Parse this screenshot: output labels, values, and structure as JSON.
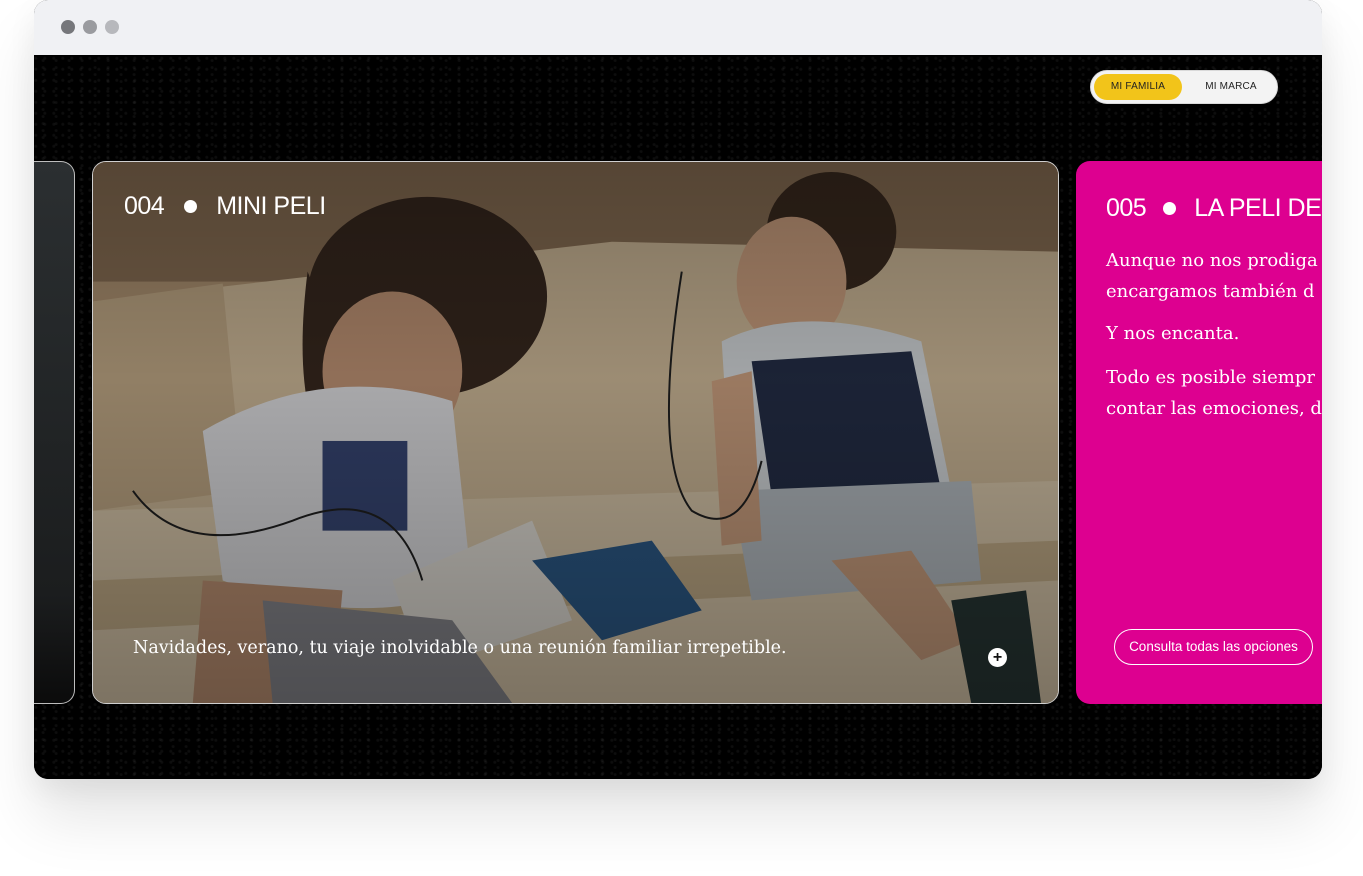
{
  "toggle": {
    "option_active": "MI FAMILIA",
    "option_inactive": "MI MARCA"
  },
  "main_card": {
    "number": "004",
    "title": "MINI PELI",
    "caption": "Navidades, verano, tu viaje inolvidable o una reunión familiar irrepetible.",
    "plus_icon": "plus-icon"
  },
  "next_card": {
    "number": "005",
    "title": "LA PELI DE",
    "paragraph_1_line_1": "Aunque no nos prodiga",
    "paragraph_1_line_2": "encargamos también d",
    "paragraph_2": "Y nos encanta.",
    "paragraph_3_line_1": "Todo es posible siempr",
    "paragraph_3_line_2": "contar las emociones, d",
    "button_label": "Consulta todas las opciones"
  },
  "colors": {
    "accent_yellow": "#f2c41a",
    "accent_magenta": "#dd0090",
    "background": "#000000"
  }
}
